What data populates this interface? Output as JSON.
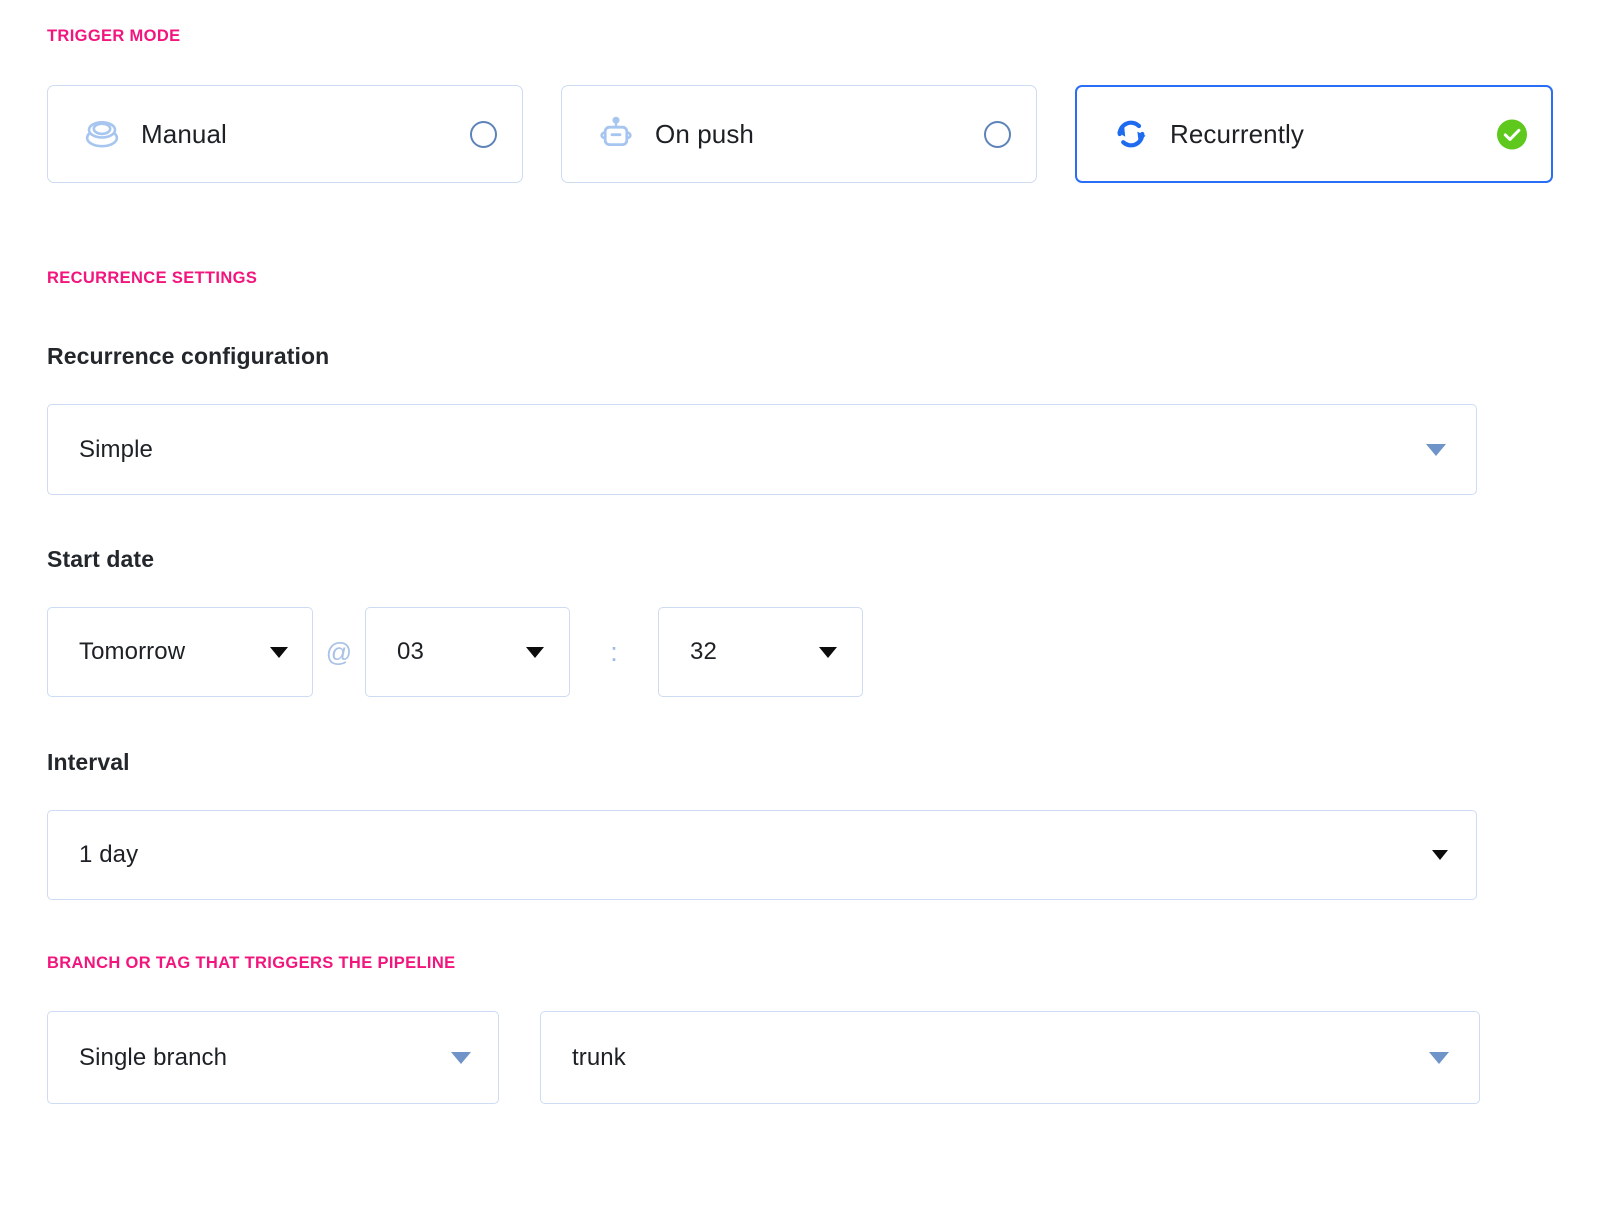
{
  "sections": {
    "trigger_mode_caption": "TRIGGER MODE",
    "recurrence_caption": "RECURRENCE SETTINGS",
    "branch_caption": "BRANCH OR TAG THAT TRIGGERS THE PIPELINE"
  },
  "trigger_modes": [
    {
      "label": "Manual",
      "icon": "layers-stack-icon",
      "selected": false,
      "state_icon": "radio-unchecked-icon"
    },
    {
      "label": "On push",
      "icon": "robot-icon",
      "selected": false,
      "state_icon": "radio-unchecked-icon"
    },
    {
      "label": "Recurrently",
      "icon": "recurring-arrow-icon",
      "selected": true,
      "state_icon": "green-check-icon"
    }
  ],
  "recurrence": {
    "config_label": "Recurrence configuration",
    "config_value": "Simple",
    "start_date_label": "Start date",
    "start_date_day": "Tomorrow",
    "at_separator": "@",
    "start_date_hour": "03",
    "time_separator": ":",
    "start_date_minute": "32",
    "interval_label": "Interval",
    "interval_value": "1 day"
  },
  "branch": {
    "mode_value": "Single branch",
    "name_value": "trunk"
  },
  "colors": {
    "caption_pink": "#f2157d",
    "selected_border_blue": "#2b6ef5",
    "field_border_blue": "#cddcf3",
    "icon_light_blue": "#a6c5ef",
    "icon_accent_blue": "#1f6bf0",
    "check_green": "#5ec81c",
    "caret_blue": "#6f94c9",
    "text_dark": "#1d2125"
  }
}
